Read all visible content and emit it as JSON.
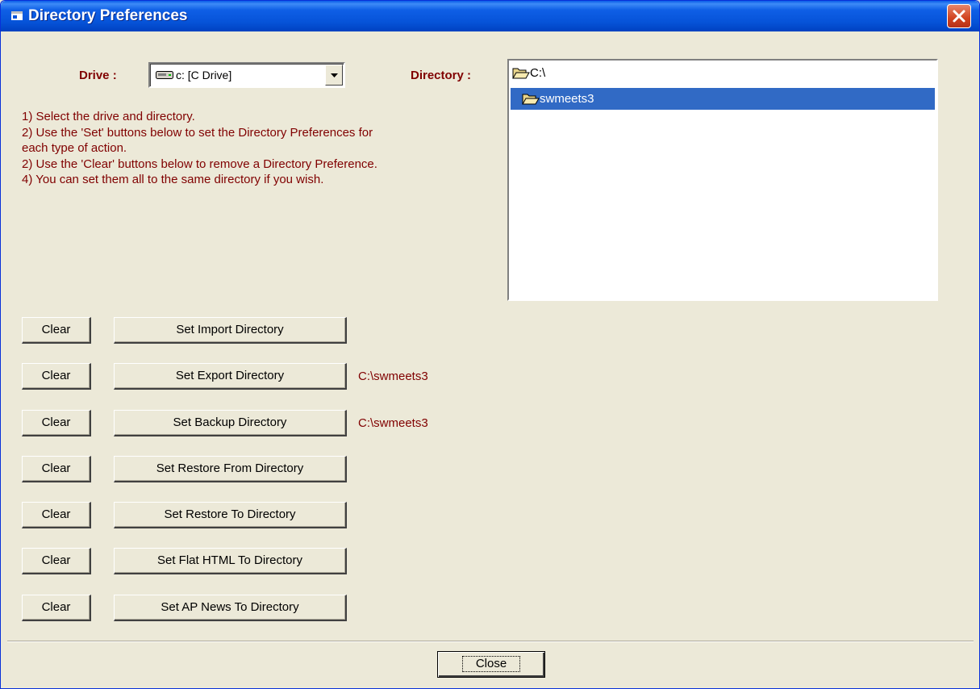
{
  "window": {
    "title": "Directory Preferences"
  },
  "drive": {
    "label": "Drive :",
    "value": "c: [C Drive]"
  },
  "directory": {
    "label": "Directory :",
    "items": [
      {
        "text": "C:\\",
        "icon": "open-folder-icon",
        "selected": false
      },
      {
        "text": "swmeets3",
        "icon": "open-folder-icon",
        "selected": true
      }
    ]
  },
  "instructions": [
    "1) Select the drive and directory.",
    "2) Use the 'Set' buttons below to set the Directory Preferences for",
    "each type of action.",
    "2) Use the 'Clear' buttons below to remove a Directory Preference.",
    "4) You can set them all to the same directory if you wish."
  ],
  "rows": [
    {
      "clear": "Clear",
      "set": "Set Import Directory",
      "path": ""
    },
    {
      "clear": "Clear",
      "set": "Set Export Directory",
      "path": "C:\\swmeets3"
    },
    {
      "clear": "Clear",
      "set": "Set Backup Directory",
      "path": "C:\\swmeets3"
    },
    {
      "clear": "Clear",
      "set": "Set Restore From Directory",
      "path": ""
    },
    {
      "clear": "Clear",
      "set": "Set Restore To Directory",
      "path": ""
    },
    {
      "clear": "Clear",
      "set": "Set Flat HTML To Directory",
      "path": ""
    },
    {
      "clear": "Clear",
      "set": "Set AP News To Directory",
      "path": ""
    }
  ],
  "footer": {
    "close_label": "Close"
  },
  "colors": {
    "accent_text": "#800000",
    "selection": "#316ac5",
    "titlebar": "#0653d8"
  }
}
